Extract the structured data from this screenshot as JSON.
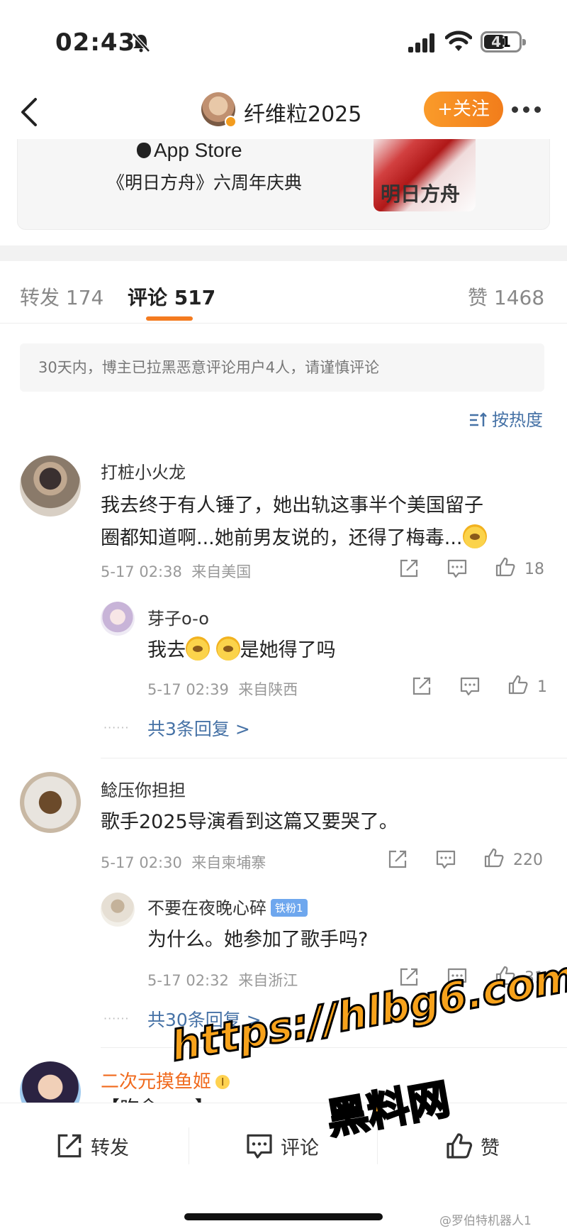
{
  "status": {
    "time": "02:43",
    "battery": "41"
  },
  "nav": {
    "title": "纤维粒2025",
    "follow_label": "+关注"
  },
  "ad": {
    "store": "App Store",
    "title": "《明日方舟》六周年庆典",
    "image_text": "明日方舟"
  },
  "tabs": [
    {
      "label": "转发 174"
    },
    {
      "label": "评论 517"
    },
    {
      "label": "赞 1468"
    }
  ],
  "notice": "30天内，博主已拉黑恶意评论用户4人，请谨慎评论",
  "sort_label": "按热度",
  "comments": [
    {
      "user": "打桩小火龙",
      "text_line1": "我去终于有人锤了，她出轨这事半个美国留子",
      "text_line2": "圈都知道啊...她前男友说的，还得了梅毒...",
      "time": "5-17 02:38",
      "location": "来自美国",
      "likes": "18",
      "reply": {
        "user": "芽子o-o",
        "text_pre": "我去",
        "text_post": "是她得了吗",
        "time": "5-17 02:39",
        "location": "来自陕西",
        "likes": "1"
      },
      "more_replies": "共3条回复 >"
    },
    {
      "user": "鲶压你担担",
      "text_line1": "歌手2025导演看到这篇又要哭了。",
      "time": "5-17 02:30",
      "location": "来自柬埔寨",
      "likes": "220",
      "reply": {
        "user": "不要在夜晚心碎",
        "badge": "铁粉1",
        "text": "为什么。她参加了歌手吗?",
        "time": "5-17 02:32",
        "location": "来自浙江",
        "likes": "31"
      },
      "more_replies": "共30条回复 >"
    },
    {
      "user": "二次元摸鱼姬",
      "badge": "I",
      "text_partial": "【咋舍......】"
    }
  ],
  "bottom_bar": {
    "repost": "转发",
    "comment": "评论",
    "like": "赞"
  },
  "watermark": {
    "line1": "https://hlbg6.com",
    "line2": "黑料网"
  },
  "credit": "@罗伯特机器人1",
  "colors": {
    "accent_orange": "#f47b20",
    "link_blue": "#4672a6"
  }
}
